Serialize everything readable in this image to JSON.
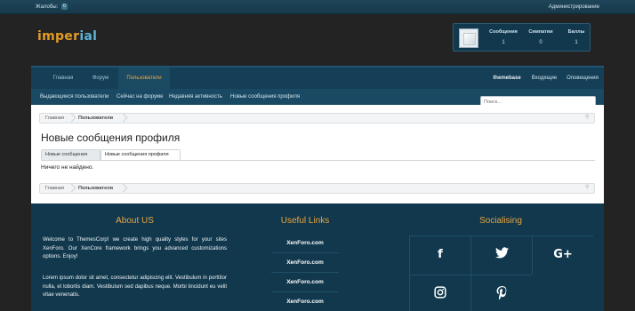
{
  "topbar": {
    "complaints_label": "Жалобы:",
    "complaints_count": "0",
    "admin_label": "Администрирование"
  },
  "logo": {
    "part1": "imper",
    "part2": "ial"
  },
  "userpanel": {
    "stats": [
      {
        "label": "Сообщения",
        "value": "1"
      },
      {
        "label": "Симпатии",
        "value": "0"
      },
      {
        "label": "Баллы",
        "value": "1"
      }
    ]
  },
  "nav": {
    "tabs": [
      "Главная",
      "Форум",
      "Пользователи"
    ],
    "active_tab": "Пользователи",
    "right": [
      "themebase",
      "Входящие",
      "Оповещения"
    ]
  },
  "subnav": {
    "links": [
      "Выдающиеся пользователи",
      "Сейчас на форуме",
      "Недавняя активность",
      "Новые сообщения профиля"
    ]
  },
  "search": {
    "placeholder": "Поиск..."
  },
  "breadcrumb": {
    "items": [
      "Главная",
      "Пользователи"
    ]
  },
  "page": {
    "title": "Новые сообщения профиля",
    "tabs": [
      "Новые сообщения",
      "Новые сообщения профиля"
    ],
    "active_tab": "Новые сообщения профиля",
    "empty_message": "Ничего не найдено."
  },
  "footer": {
    "about": {
      "heading": "About US",
      "p1": "Welcome to ThemesCorp! we create high quality styles for your sites XenForo. Our XenCore framework brings you advanced customizations options. Enjoy!",
      "p2": "Lorem ipsum dolor sit amet, consectetur adipiscing elit. Vestibulum in porttitor nulla, et lobortis diam. Vestibulum sed dapibus neque. Morbi tincidunt eu velit vitae venenatis."
    },
    "links": {
      "heading": "Useful Links",
      "items": [
        "XenForo.com",
        "XenForo.com",
        "XenForo.com",
        "XenForo.com"
      ]
    },
    "social": {
      "heading": "Socialising",
      "icons": [
        "facebook-icon",
        "twitter-icon",
        "google-plus-icon",
        "instagram-icon",
        "pinterest-icon"
      ]
    }
  }
}
